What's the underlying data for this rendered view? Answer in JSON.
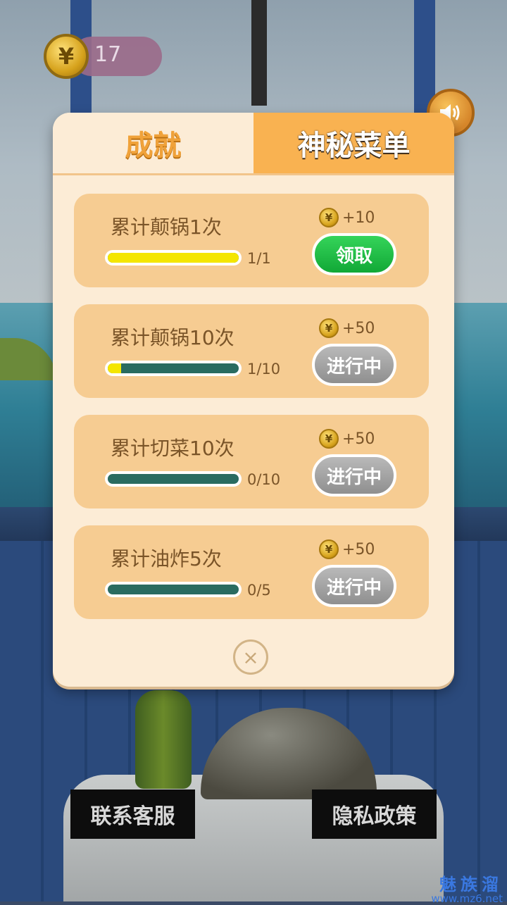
{
  "hud": {
    "coin_icon": "yen-coin-icon",
    "coin_glyph": "¥",
    "coin_count": "17",
    "sound_icon": "speaker-icon"
  },
  "tabs": [
    {
      "label": "成就",
      "active": false
    },
    {
      "label": "神秘菜单",
      "active": true
    }
  ],
  "achievements": [
    {
      "title": "累计颠锅1次",
      "progress_text": "1/1",
      "progress": 1.0,
      "reward": "+10",
      "button": "领取",
      "state": "claim"
    },
    {
      "title": "累计颠锅10次",
      "progress_text": "1/10",
      "progress": 0.1,
      "reward": "+50",
      "button": "进行中",
      "state": "in_progress"
    },
    {
      "title": "累计切菜10次",
      "progress_text": "0/10",
      "progress": 0.0,
      "reward": "+50",
      "button": "进行中",
      "state": "in_progress"
    },
    {
      "title": "累计油炸5次",
      "progress_text": "0/5",
      "progress": 0.0,
      "reward": "+50",
      "button": "进行中",
      "state": "in_progress"
    }
  ],
  "reward_coin_glyph": "¥",
  "close_glyph": "×",
  "bottom": {
    "contact_label": "联系客服",
    "privacy_label": "隐私政策"
  },
  "watermark": {
    "line1": "魅族溜",
    "line2": "www.mz6.net"
  },
  "colors": {
    "panel_bg": "#fcecd6",
    "card_bg": "#f6cc92",
    "active_tab": "#f9b251",
    "claim_green": "#1fbb45",
    "progress_gray": "#a3a3a3",
    "bar_yellow": "#f4e600",
    "bar_track": "#2a6b60"
  }
}
